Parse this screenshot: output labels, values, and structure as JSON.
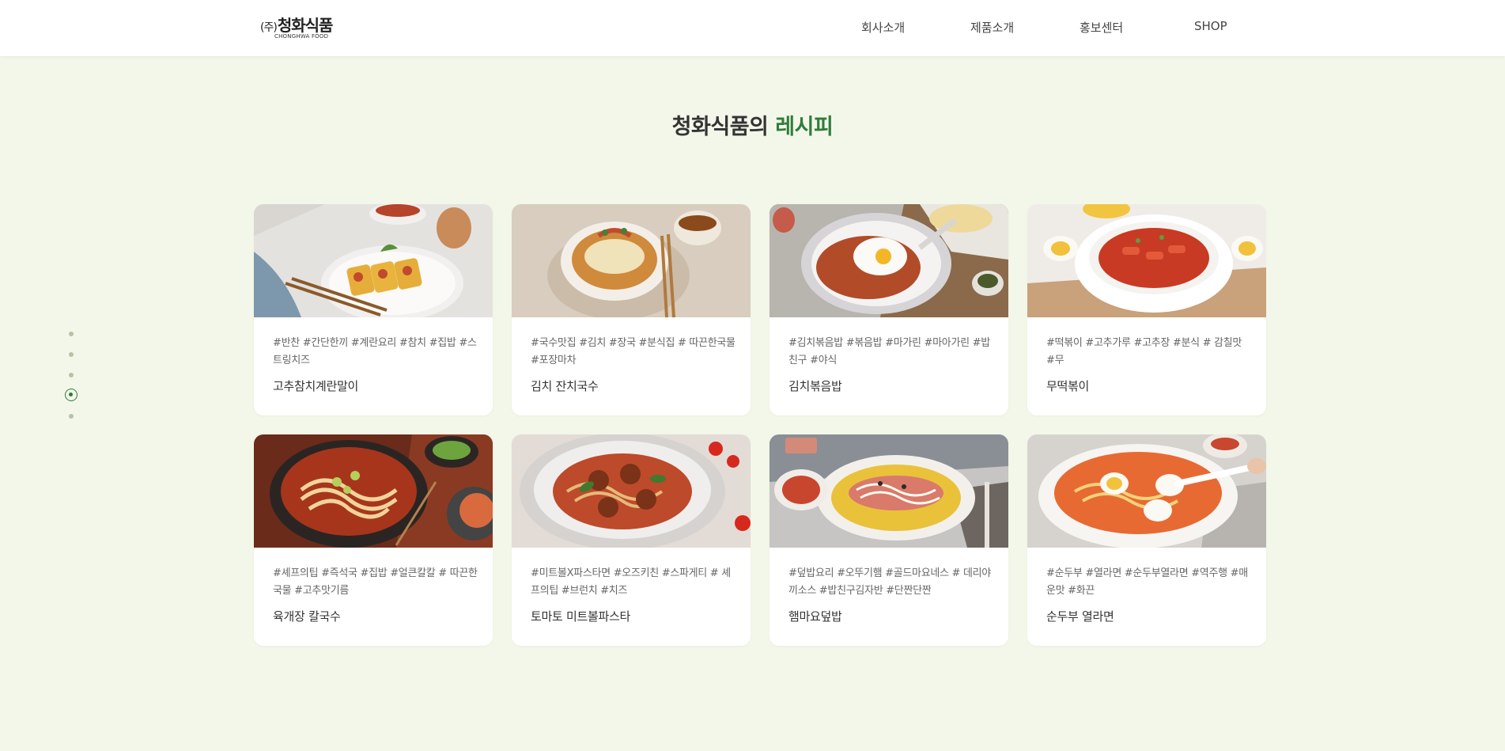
{
  "header": {
    "logo_prefix": "(주)",
    "logo_main": "청화식품",
    "logo_sub": "CHONGHWA FOOD",
    "nav": [
      "회사소개",
      "제품소개",
      "홍보센터",
      "SHOP"
    ]
  },
  "title": {
    "main": "청화식품의 ",
    "accent": "레시피",
    "accent_color": "#2f7d3b"
  },
  "pagination": {
    "count": 5,
    "active_index": 3
  },
  "cards": [
    {
      "tags": "#반찬 #간단한끼 #계란요리 #참치 #집밥 #스트링치즈",
      "title": "고추참치계란말이",
      "image": "rolled-omelette-photo"
    },
    {
      "tags": "#국수맛집 #김치 #장국 #분식집 # 따끈한국물 #포장마차",
      "title": "김치 잔치국수",
      "image": "kimchi-noodle-soup-photo"
    },
    {
      "tags": "#김치볶음밥 #볶음밥 #마가린 #마아가린 #밥친구 #야식",
      "title": "김치볶음밥",
      "image": "kimchi-fried-rice-photo"
    },
    {
      "tags": "#떡볶이 #고추가루 #고추장 #분식 # 감칠맛 #무",
      "title": "무떡볶이",
      "image": "tteokbokki-photo"
    },
    {
      "tags": "#셰프의팁 #즉석국 #집밥 #얼큰칼칼 # 따끈한국물 #고추맛기름",
      "title": "육개장 칼국수",
      "image": "spicy-noodle-soup-photo"
    },
    {
      "tags": "#미트볼X파스타면 #오즈키친 #스파게티 # 셰프의팁 #브런치 #치즈",
      "title": "토마토 미트볼파스타",
      "image": "meatball-pasta-photo"
    },
    {
      "tags": "#덮밥요리 #오뚜기햄 #골드마요네스 # 데리야끼소스 #밥친구김자반 #단짠단짠",
      "title": "햄마요덮밥",
      "image": "ham-mayo-rice-bowl-photo"
    },
    {
      "tags": "#순두부 #열라면 #순두부열라면 #역주행 #매운맛 #화끈",
      "title": "순두부 열라면",
      "image": "soft-tofu-ramen-photo"
    }
  ]
}
